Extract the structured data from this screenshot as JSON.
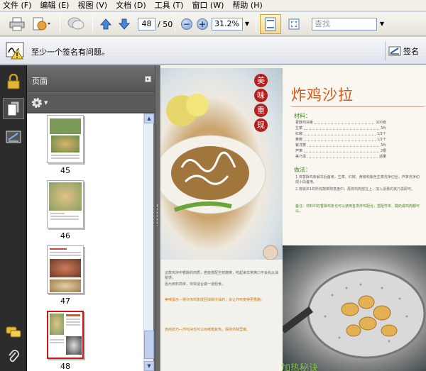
{
  "menu": {
    "items": [
      "文件 (F)",
      "编辑 (E)",
      "视图 (V)",
      "文档 (D)",
      "工具 (T)",
      "窗口 (W)",
      "帮助 (H)"
    ]
  },
  "toolbar": {
    "page_current": "48",
    "page_total": "/ 50",
    "zoom_value": "31.2%",
    "find_placeholder": "查找",
    "icons": [
      "printer-icon",
      "create-pdf-icon",
      "comment-icon",
      "prev-page-icon",
      "next-page-icon",
      "zoom-out-icon",
      "zoom-in-icon",
      "fit-page-icon",
      "full-screen-icon"
    ]
  },
  "message_bar": {
    "text": "至少一个签名有问题。",
    "signature_button": "签名"
  },
  "nav_strip": {
    "icons": [
      "lock-icon",
      "pages-icon",
      "signature-icon",
      "comments-icon",
      "attachments-icon"
    ]
  },
  "pages_panel": {
    "title": "页面",
    "thumbnails": [
      {
        "label": "45",
        "selected": false
      },
      {
        "label": "46",
        "selected": false
      },
      {
        "label": "47",
        "selected": false
      },
      {
        "label": "48",
        "selected": true
      }
    ]
  },
  "document": {
    "stamp_chars": [
      "美",
      "味",
      "重",
      "现"
    ],
    "recipe_title": "炸鸡沙拉",
    "ingredients_heading": "材料：",
    "ingredients": [
      {
        "name": "香酥鸡块条",
        "qty": "100克"
      },
      {
        "name": "生菜",
        "qty": "3片"
      },
      {
        "name": "红椒",
        "qty": "1/2个"
      },
      {
        "name": "黄椒",
        "qty": "1/2个"
      },
      {
        "name": "紫洋葱",
        "qty": "3片"
      },
      {
        "name": "芦笋",
        "qty": "2根"
      },
      {
        "name": "美乃滋",
        "qty": "适量"
      }
    ],
    "method_heading": "做法：",
    "method_steps": [
      "1.将香酥鸡条解冻后备用，生菜、红椒、黄椒和紫色生菜洗净切丝，芦笋洗净切成小段备用。",
      "2.将做法1的所有蔬菜随意盘中，再将鸡肉放在上，加入适量的美乃滋即可。"
    ],
    "note": "备注：材料中的香酥鸡条也可以使用各类炸鸡配合，搭配芥末、酸奶或鸡肉都可以。",
    "left_text": [
      "这款鸡块中香酥的肉质，若能搭配生鲜蔬菜，吃起来非常爽口不会有太油腻感，",
      "因为用料简单，非常适合做一道轻食。",
      "美味提示—将冷冻鸡条放回油锅中油炸，会让炸鸡变得更香脆。",
      "食用技巧—炸鸡块也可以用烤箱复热，保持外酥里嫩。"
    ],
    "bottom_title": "加热秘诀"
  }
}
